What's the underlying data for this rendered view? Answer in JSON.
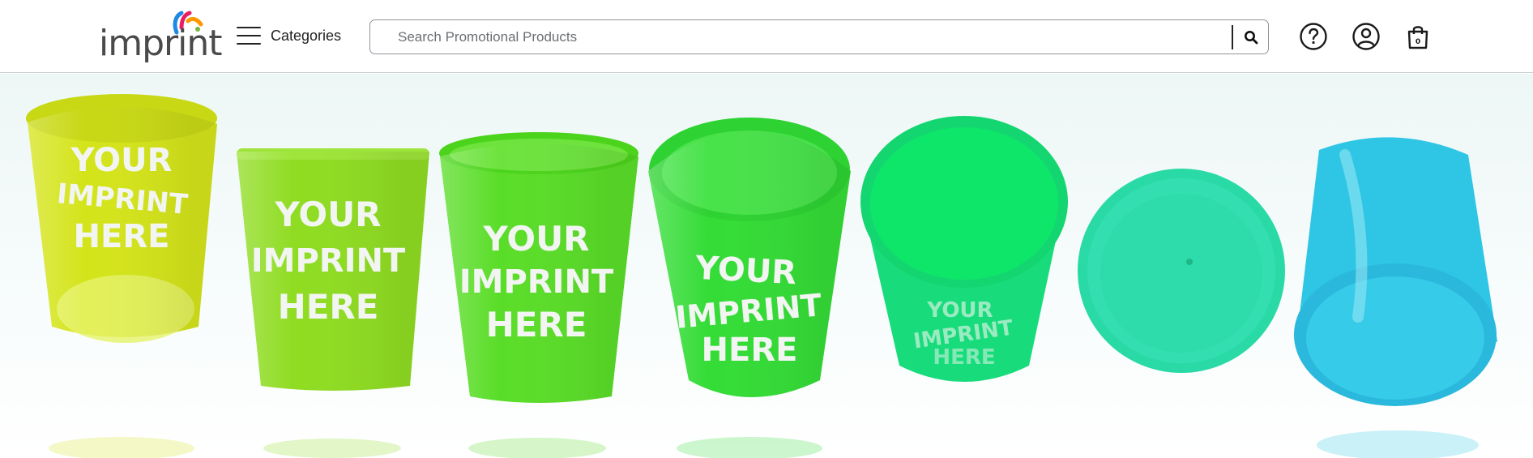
{
  "header": {
    "logo": {
      "text": "imprint",
      "colors": [
        "#1e88e5",
        "#e91e63",
        "#ff9800",
        "#7cb342"
      ]
    },
    "categories_label": "Categories",
    "search": {
      "placeholder": "Search Promotional Products",
      "value": ""
    },
    "icons": [
      "search-icon",
      "help-icon",
      "account-icon",
      "cart-icon"
    ],
    "cart_count": "0"
  },
  "hero": {
    "imprint_lines": [
      "YOUR",
      "IMPRINT",
      "HERE"
    ],
    "cup_colors": [
      "#d4e41a",
      "#8fdc22",
      "#5add28",
      "#34dc36",
      "#18dc7c",
      "#2adaa6",
      "#2ec6e4"
    ]
  }
}
